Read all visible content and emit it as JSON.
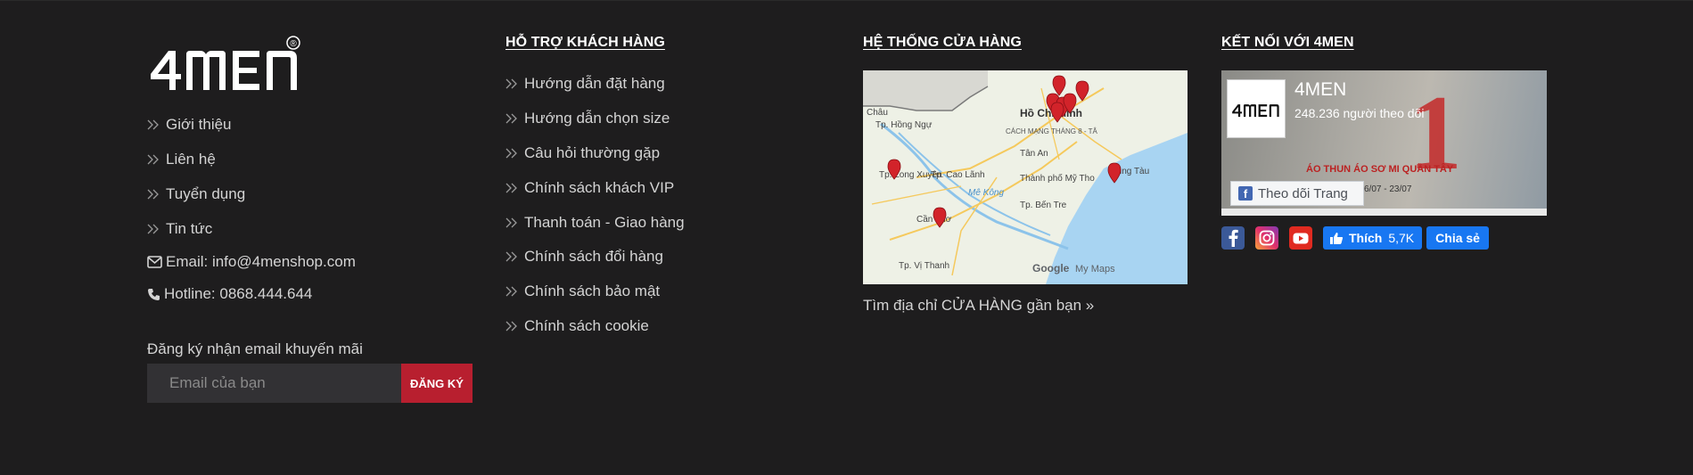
{
  "brand": {
    "logo_text": "4MEN",
    "registered_mark": "®"
  },
  "about": {
    "links": [
      {
        "label": "Giới thiệu"
      },
      {
        "label": "Liên hệ"
      },
      {
        "label": "Tuyển dụng"
      },
      {
        "label": "Tin tức"
      }
    ],
    "email": "Email: info@4menshop.com",
    "hotline": "Hotline: 0868.444.644"
  },
  "newsletter": {
    "label": "Đăng ký nhận email khuyến mãi",
    "placeholder": "Email của bạn",
    "button_label": "ĐĂNG KÝ"
  },
  "support": {
    "heading": "HỖ TRỢ KHÁCH HÀNG",
    "links": [
      {
        "label": "Hướng dẫn đặt hàng"
      },
      {
        "label": "Hướng dẫn chọn size"
      },
      {
        "label": "Câu hỏi thường gặp"
      },
      {
        "label": "Chính sách khách VIP"
      },
      {
        "label": "Thanh toán - Giao hàng"
      },
      {
        "label": "Chính sách đổi hàng"
      },
      {
        "label": "Chính sách bảo mật"
      },
      {
        "label": "Chính sách cookie"
      }
    ]
  },
  "stores": {
    "heading": "HỆ THỐNG CỬA HÀNG",
    "map_labels": [
      "Hồ Chí Minh",
      "Tp. Hồng Ngự",
      "Châu",
      "Tp. Cao Lãnh",
      "Tp. Long Xuyên",
      "Cần Thơ",
      "Tp. Vị Thanh",
      "Tân An",
      "Thành phố Mỹ Tho",
      "Tp. Bến Tre",
      "Vũng Tàu",
      "CÁCH MẠNG THÁNG 8 - TÂ",
      "Mê Kông",
      "Google",
      "My Maps"
    ],
    "find_link": "Tìm địa chỉ CỬA HÀNG gần bạn »"
  },
  "connect": {
    "heading": "KẾT NỐI VỚI 4MEN",
    "fb_page_name": "4MEN",
    "fb_followers": "248.236 người theo dõi",
    "fb_follow_button": "Theo dõi Trang",
    "promo_text": "1",
    "promo_items": "ÁO THUN  ÁO SƠ MI  QUẦN TÂY",
    "promo_date": "6/07 - 23/07",
    "like_label": "Thích",
    "like_count": "5,7K",
    "share_label": "Chia sẻ"
  },
  "colors": {
    "background": "#1e1d1e",
    "accent_red": "#b81f2f",
    "facebook_blue": "#1877f2"
  }
}
